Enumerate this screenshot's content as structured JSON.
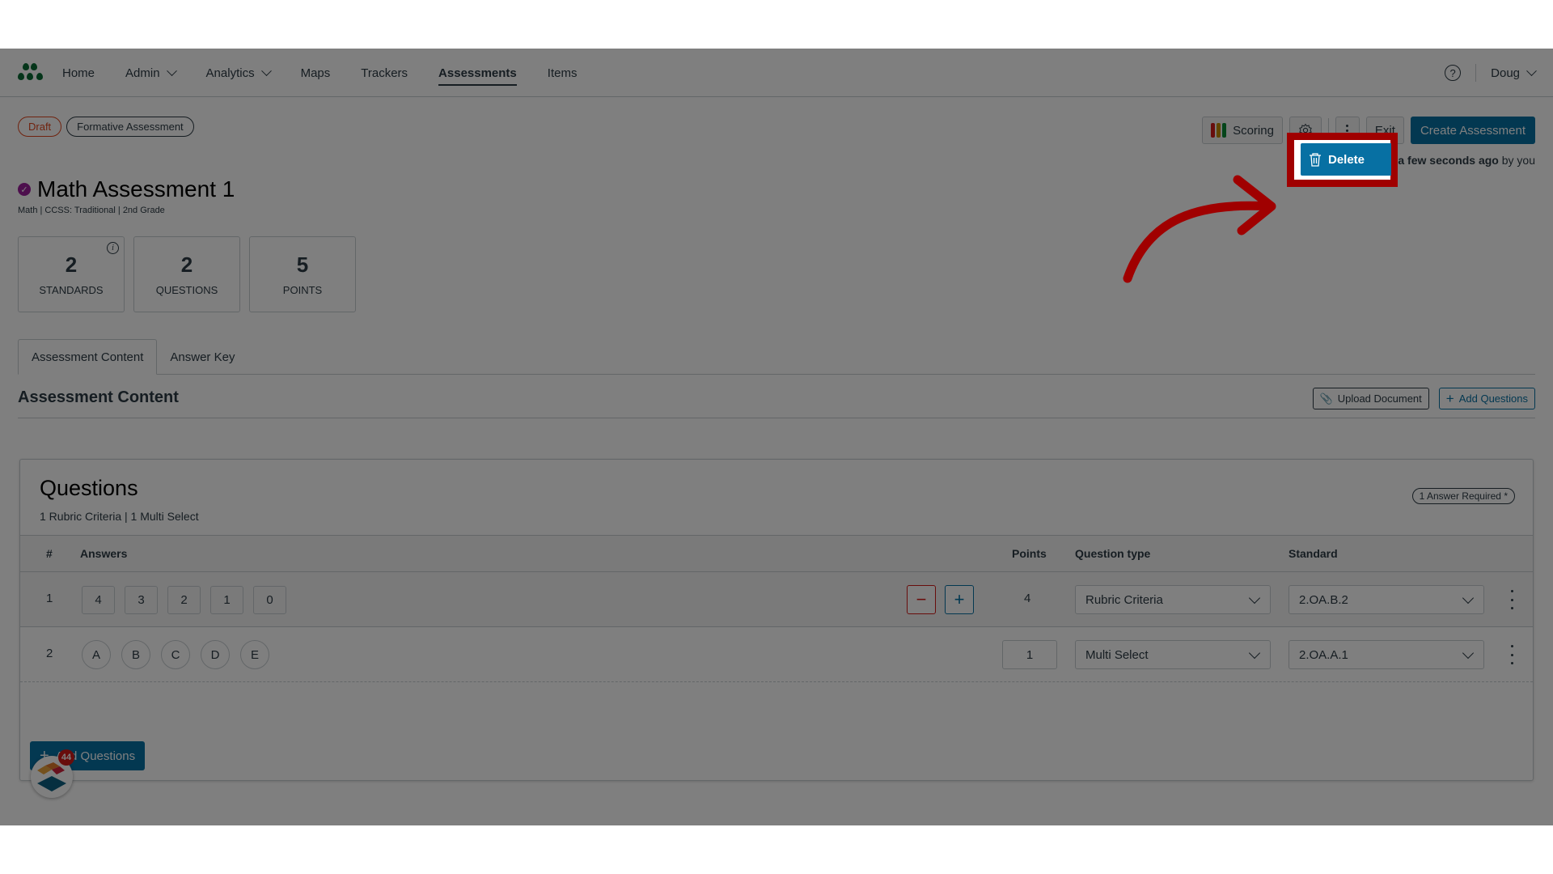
{
  "nav": {
    "items": [
      {
        "label": "Home",
        "dropdown": false,
        "active": false
      },
      {
        "label": "Admin",
        "dropdown": true,
        "active": false
      },
      {
        "label": "Analytics",
        "dropdown": true,
        "active": false
      },
      {
        "label": "Maps",
        "dropdown": false,
        "active": false
      },
      {
        "label": "Trackers",
        "dropdown": false,
        "active": false
      },
      {
        "label": "Assessments",
        "dropdown": false,
        "active": true
      },
      {
        "label": "Items",
        "dropdown": false,
        "active": false
      }
    ],
    "help_icon": "question-circle-icon",
    "user": "Doug"
  },
  "badges": {
    "status": "Draft",
    "type": "Formative Assessment"
  },
  "toolbar": {
    "scoring_label": "Scoring",
    "settings_icon": "gear-icon",
    "more_icon": "kebab-vertical-icon",
    "exit_label": "Exit",
    "create_label": "Create Assessment"
  },
  "saved_status": {
    "time": "a few seconds ago",
    "by": "by you"
  },
  "menu": {
    "delete_label": "Delete",
    "delete_icon": "trash-icon"
  },
  "assessment": {
    "title": "Math Assessment 1",
    "subtitle": "Math  |  CCSS: Traditional  |  2nd Grade"
  },
  "stats": [
    {
      "value": "2",
      "label": "STANDARDS",
      "info": true
    },
    {
      "value": "2",
      "label": "QUESTIONS",
      "info": false
    },
    {
      "value": "5",
      "label": "POINTS",
      "info": false
    }
  ],
  "tabs": [
    {
      "label": "Assessment Content",
      "active": true
    },
    {
      "label": "Answer Key",
      "active": false
    }
  ],
  "content": {
    "title": "Assessment Content",
    "upload_label": "Upload Document",
    "add_questions_label": "Add Questions"
  },
  "questions": {
    "title": "Questions",
    "summary": "1 Rubric Criteria | 1 Multi Select",
    "answer_required": "1 Answer Required *",
    "columns": {
      "num": "#",
      "answers": "Answers",
      "points": "Points",
      "type": "Question type",
      "standard": "Standard"
    },
    "rows": [
      {
        "num": "1",
        "answers": [
          "4",
          "3",
          "2",
          "1",
          "0"
        ],
        "points": "4",
        "type": "Rubric Criteria",
        "standard": "2.OA.B.2"
      },
      {
        "num": "2",
        "answers": [
          "A",
          "B",
          "C",
          "D",
          "E"
        ],
        "points": "1",
        "type": "Multi Select",
        "standard": "2.OA.A.1"
      }
    ],
    "add_label": "Add Questions"
  },
  "helper_widget": {
    "badge_count": "44"
  },
  "colors": {
    "primary": "#0770a3",
    "draft": "#e0461e",
    "danger": "#d01a19",
    "highlight": "#a00000",
    "logo_green": "#0b6b34",
    "verified": "#9b1f9b",
    "scoring_bars": [
      "#d01a19",
      "#c28a00",
      "#0b8a34"
    ]
  }
}
